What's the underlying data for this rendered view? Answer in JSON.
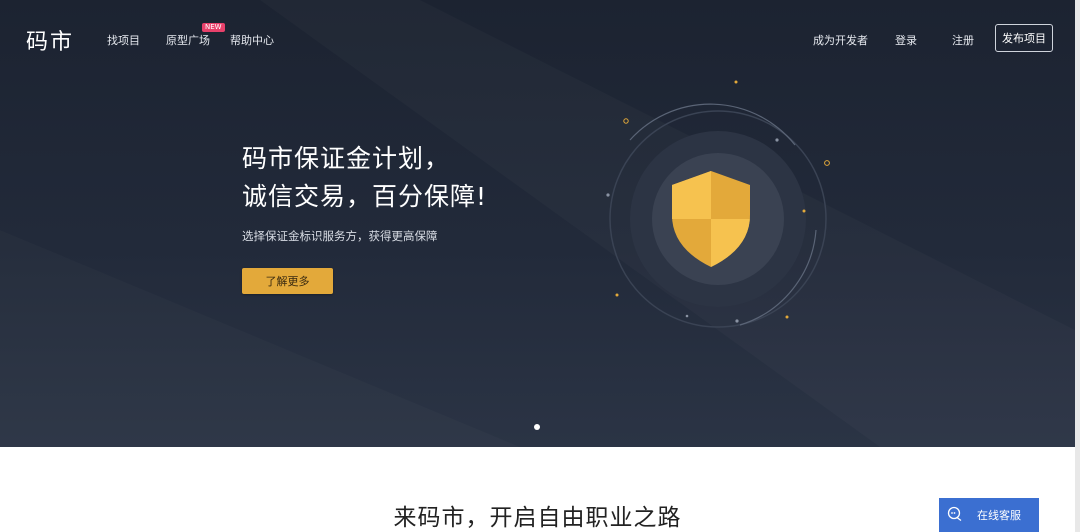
{
  "nav": {
    "logo": "码市",
    "links": [
      "找项目",
      "原型广场",
      "帮助中心"
    ],
    "badge": "NEW",
    "right_links": [
      "成为开发者",
      "登录",
      "注册"
    ],
    "publish": "发布项目"
  },
  "hero": {
    "title_line1": "码市保证金计划，",
    "title_line2": "诚信交易，百分保障!",
    "subtitle": "选择保证金标识服务方，获得更高保障",
    "cta": "了解更多"
  },
  "section": {
    "title": "来码市，开启自由职业之路"
  },
  "support": {
    "label": "在线客服",
    "icon": "chat-icon"
  },
  "colors": {
    "hero_bg": "#222a3a",
    "accent": "#e3a93a",
    "badge": "#e8416b",
    "support": "#3b6fd1"
  }
}
